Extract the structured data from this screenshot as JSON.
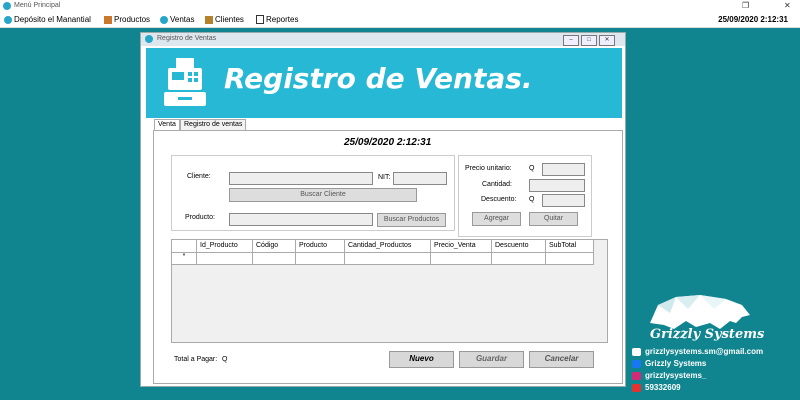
{
  "main_window": {
    "title": "Menú Principal",
    "menu": [
      {
        "label": "Depósito el Manantial",
        "icon": "company-icon"
      },
      {
        "label": "Productos",
        "icon": "products-icon"
      },
      {
        "label": "Ventas",
        "icon": "sales-icon"
      },
      {
        "label": "Clientes",
        "icon": "clients-icon"
      },
      {
        "label": "Reportes",
        "icon": "reports-icon"
      }
    ],
    "datetime": "25/09/2020 2:12:31"
  },
  "child_window": {
    "title": "Registro de Ventas",
    "banner_title": "Registro de Ventas.",
    "tabs": [
      {
        "label": "Venta"
      },
      {
        "label": "Registro de ventas"
      }
    ],
    "sale_datetime": "25/09/2020 2:12:31",
    "form": {
      "cliente_label": "Cliente:",
      "nit_label": "NIT:",
      "buscar_cliente": "Buscar Cliente",
      "producto_label": "Producto:",
      "buscar_productos": "Buscar Productos",
      "precio_unitario_label": "Precio unitario:",
      "precio_currency": "Q",
      "cantidad_label": "Cantidad:",
      "descuento_label": "Descuento:",
      "descuento_currency": "Q",
      "agregar": "Agregar",
      "quitar": "Quitar"
    },
    "table": {
      "columns": [
        "Id_Producto",
        "Código",
        "Producto",
        "Cantidad_Productos",
        "Precio_Venta",
        "Descuento",
        "SubTotal"
      ],
      "new_row_marker": "*"
    },
    "total_label": "Total a Pagar:",
    "total_value": "Q",
    "buttons": {
      "nuevo": "Nuevo",
      "guardar": "Guardar",
      "cancelar": "Cancelar"
    }
  },
  "contact": {
    "brand": "Grizzly Systems",
    "email": "grizzlysystems.sm@gmail.com",
    "facebook": "Grizzly Systems",
    "instagram": "grizzlysystems_",
    "phone": "59332609"
  }
}
